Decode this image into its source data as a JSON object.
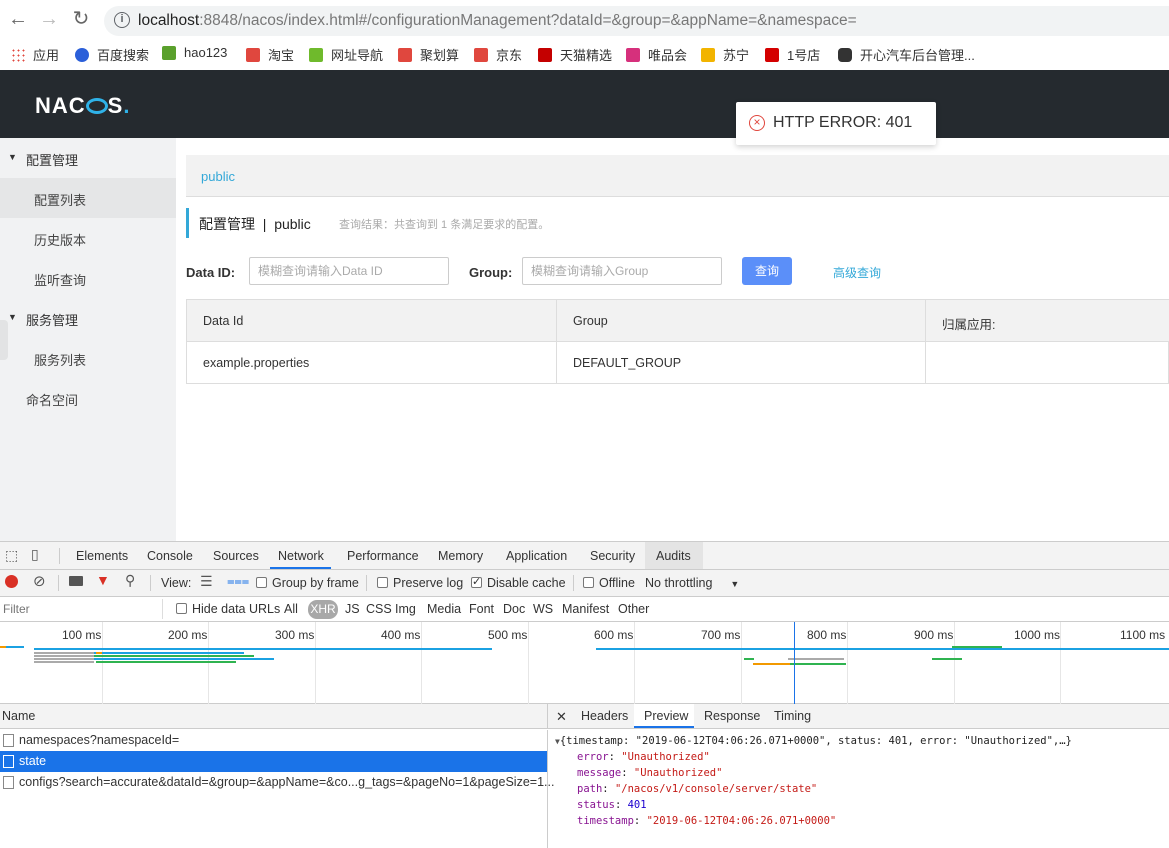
{
  "browser": {
    "url_host": "localhost",
    "url_rest": ":8848/nacos/index.html#/configurationManagement?dataId=&group=&appName=&namespace=",
    "bookmarks": [
      {
        "label": "应用",
        "icon": "apps-grid-icon",
        "color": "#e0473e"
      },
      {
        "label": "百度搜索",
        "icon": "baidu-paw-icon",
        "color": "#2b5fd9"
      },
      {
        "label": "hao123",
        "icon": "hao123-icon",
        "color": "#5aa02c"
      },
      {
        "label": "淘宝",
        "icon": "taobao-icon",
        "color": "#e0473e"
      },
      {
        "label": "网址导航",
        "icon": "7654-icon",
        "color": "#6fba2c"
      },
      {
        "label": "聚划算",
        "icon": "juhuasuan-icon",
        "color": "#e0473e"
      },
      {
        "label": "京东",
        "icon": "jd-icon",
        "color": "#e0473e"
      },
      {
        "label": "天猫精选",
        "icon": "tmall-icon",
        "color": "#c40000"
      },
      {
        "label": "唯品会",
        "icon": "vip-icon",
        "color": "#d6307c"
      },
      {
        "label": "苏宁",
        "icon": "suning-icon",
        "color": "#f2b400"
      },
      {
        "label": "1号店",
        "icon": "yhd-icon",
        "color": "#d40000"
      },
      {
        "label": "开心汽车后台管理...",
        "icon": "car-icon",
        "color": "#333333"
      }
    ]
  },
  "toast": {
    "text": "HTTP ERROR: 401"
  },
  "sidebar": {
    "groups": [
      {
        "label": "配置管理"
      },
      {
        "label": "服务管理"
      }
    ],
    "items": [
      {
        "label": "配置列表"
      },
      {
        "label": "历史版本"
      },
      {
        "label": "监听查询"
      },
      {
        "label": "服务列表"
      },
      {
        "label": "命名空间"
      }
    ]
  },
  "main": {
    "namespace_tab": "public",
    "title": "配置管理  |  public",
    "result_hint": "查询结果：共查询到 1 条满足要求的配置。",
    "data_id_label": "Data ID:",
    "data_id_placeholder": "模糊查询请输入Data ID",
    "group_label": "Group:",
    "group_placeholder": "模糊查询请输入Group",
    "query_button": "查询",
    "advanced_query": "高级查询",
    "table": {
      "headers": [
        "Data Id",
        "Group",
        "归属应用:"
      ],
      "rows": [
        [
          "example.properties",
          "DEFAULT_GROUP",
          ""
        ]
      ]
    }
  },
  "devtools": {
    "tabs": [
      "Elements",
      "Console",
      "Sources",
      "Network",
      "Performance",
      "Memory",
      "Application",
      "Security",
      "Audits"
    ],
    "toolbar": {
      "view": "View:",
      "group_by_frame": "Group by frame",
      "preserve_log": "Preserve log",
      "disable_cache": "Disable cache",
      "offline": "Offline",
      "throttling": "No throttling"
    },
    "filter": {
      "placeholder": "Filter",
      "hide_data_urls": "Hide data URLs",
      "types": [
        "All",
        "XHR",
        "JS",
        "CSS",
        "Img",
        "Media",
        "Font",
        "Doc",
        "WS",
        "Manifest",
        "Other"
      ]
    },
    "timeline_ticks": [
      "100 ms",
      "200 ms",
      "300 ms",
      "400 ms",
      "500 ms",
      "600 ms",
      "700 ms",
      "800 ms",
      "900 ms",
      "1000 ms",
      "1100 ms"
    ],
    "name_header": "Name",
    "requests": [
      "namespaces?namespaceId=",
      "state",
      "configs?search=accurate&dataId=&group=&appName=&co...g_tags=&pageNo=1&pageSize=1..."
    ],
    "detail_tabs": [
      "Headers",
      "Preview",
      "Response",
      "Timing"
    ],
    "preview": {
      "summary": "{timestamp: \"2019-06-12T04:06:26.071+0000\", status: 401, error: \"Unauthorized\",…}",
      "error": "\"Unauthorized\"",
      "message": "\"Unauthorized\"",
      "path": "\"/nacos/v1/console/server/state\"",
      "status": "401",
      "timestamp": "\"2019-06-12T04:06:26.071+0000\""
    }
  }
}
